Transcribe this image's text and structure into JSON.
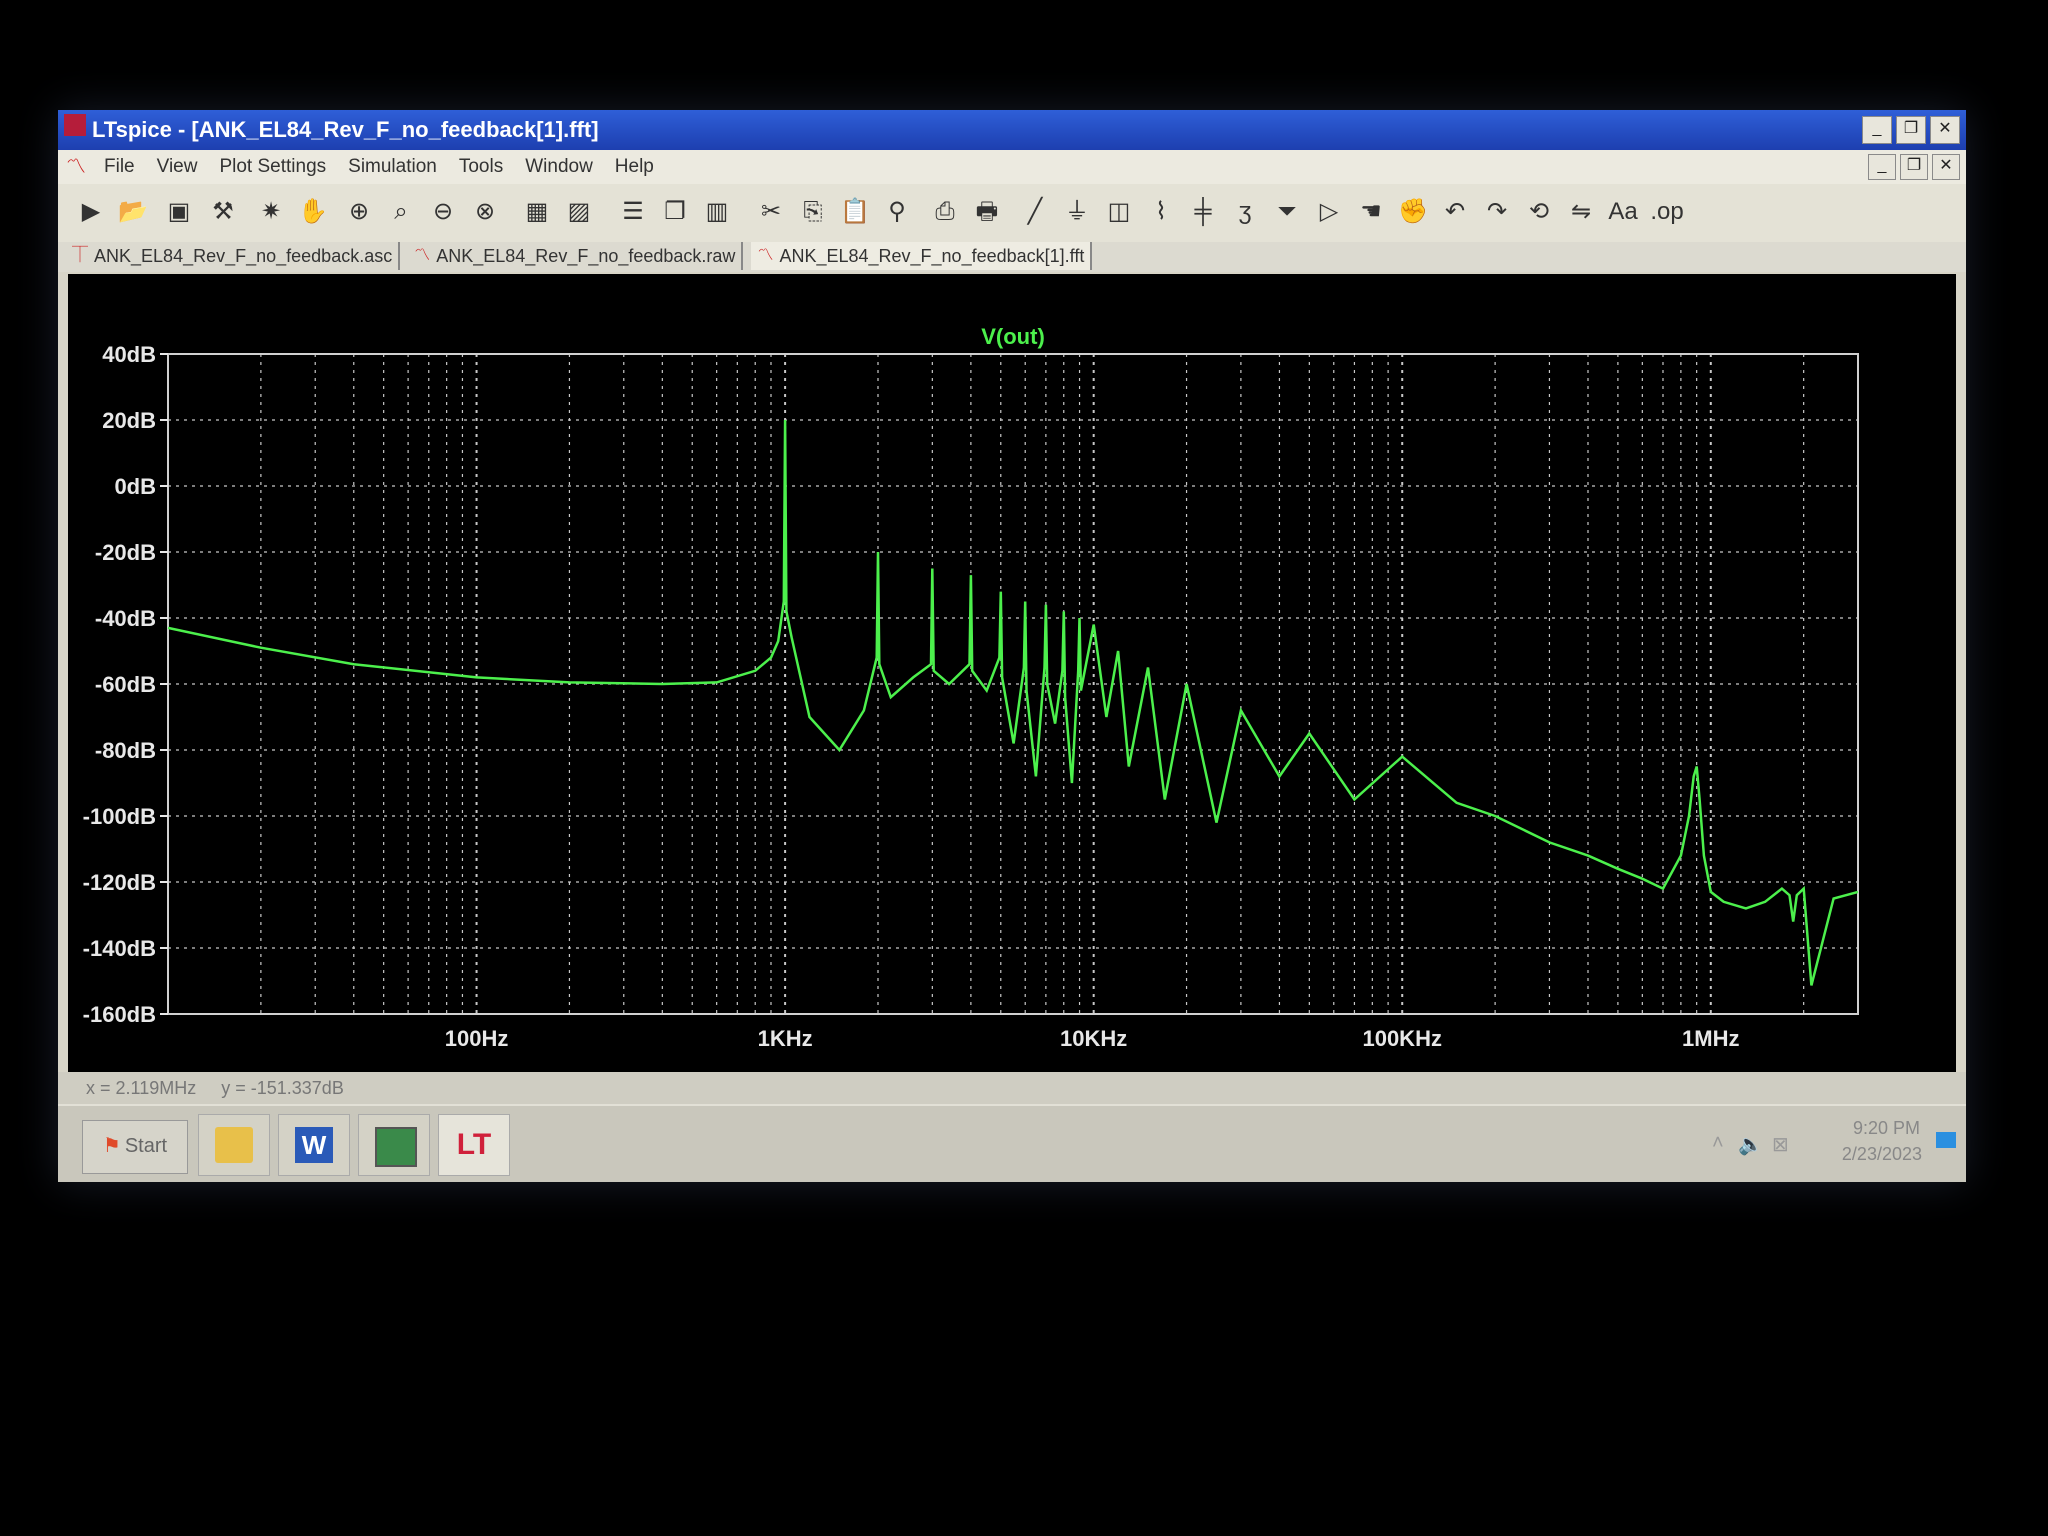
{
  "window": {
    "title": "LTspice - [ANK_EL84_Rev_F_no_feedback[1].fft]",
    "controls": {
      "minimize": "_",
      "restore": "❐",
      "close": "✕"
    }
  },
  "menu": [
    "File",
    "View",
    "Plot Settings",
    "Simulation",
    "Tools",
    "Window",
    "Help"
  ],
  "toolbar": [
    "run-icon",
    "open-icon",
    "save-icon",
    "control-panel-icon",
    "halt-icon",
    "pan-icon",
    "zoom-in-icon",
    "zoom-fit-icon",
    "zoom-out-icon",
    "zoom-cancel-icon",
    "autorange-icon",
    "zoom-area-icon",
    "tile-horizontal-icon",
    "cascade-icon",
    "tile-vertical-icon",
    "cut-icon",
    "copy-icon",
    "paste-icon",
    "find-icon",
    "print-preview-icon",
    "print-icon",
    "wire-icon",
    "ground-icon",
    "label-icon",
    "resistor-icon",
    "capacitor-icon",
    "inductor-icon",
    "diode-icon",
    "component-icon",
    "move-icon",
    "drag-icon",
    "undo-icon",
    "redo-icon",
    "rotate-icon",
    "mirror-icon",
    "text-icon",
    "spice-directive-icon"
  ],
  "tabs": [
    {
      "label": "ANK_EL84_Rev_F_no_feedback.asc",
      "icon": "schematic-icon",
      "active": false
    },
    {
      "label": "ANK_EL84_Rev_F_no_feedback.raw",
      "icon": "waveform-icon",
      "active": false
    },
    {
      "label": "ANK_EL84_Rev_F_no_feedback[1].fft",
      "icon": "waveform-icon",
      "active": true
    }
  ],
  "status": {
    "x": "x = 2.119MHz",
    "y": "y = -151.337dB"
  },
  "taskbar": {
    "start_label": "Start",
    "apps": [
      "file-explorer-icon",
      "word-icon",
      "monitor-app-icon",
      "ltspice-icon"
    ],
    "time": "9:20 PM",
    "date": "2/23/2023"
  },
  "colors": {
    "trace": "#4cf04c",
    "grid": "#c8c8c8",
    "plot_bg": "#000000",
    "title_bar": "#2a56d0"
  },
  "chart_data": {
    "type": "line",
    "title": "V(out)",
    "xscale": "log",
    "xlim": [
      10,
      3000000
    ],
    "ylim": [
      -160,
      40
    ],
    "grid": true,
    "xticks": [
      {
        "value": 100,
        "label": "100Hz"
      },
      {
        "value": 1000,
        "label": "1KHz"
      },
      {
        "value": 10000,
        "label": "10KHz"
      },
      {
        "value": 100000,
        "label": "100KHz"
      },
      {
        "value": 1000000,
        "label": "1MHz"
      }
    ],
    "yticks": [
      {
        "value": 40,
        "label": "40dB"
      },
      {
        "value": 20,
        "label": "20dB"
      },
      {
        "value": 0,
        "label": "0dB"
      },
      {
        "value": -20,
        "label": "-20dB"
      },
      {
        "value": -40,
        "label": "-40dB"
      },
      {
        "value": -60,
        "label": "-60dB"
      },
      {
        "value": -80,
        "label": "-80dB"
      },
      {
        "value": -100,
        "label": "-100dB"
      },
      {
        "value": -120,
        "label": "-120dB"
      },
      {
        "value": -140,
        "label": "-140dB"
      },
      {
        "value": -160,
        "label": "-160dB"
      }
    ],
    "series": [
      {
        "x": [
          10,
          20,
          40,
          100,
          200,
          400,
          600,
          800,
          900,
          950,
          990,
          1000,
          1010,
          1050,
          1200,
          1500,
          1800,
          1980,
          2000,
          2020,
          2200,
          2600,
          2970,
          3000,
          3030,
          3400,
          3960,
          4000,
          4040,
          4500,
          4950,
          5000,
          5050,
          5500,
          5940,
          6000,
          6060,
          6500,
          6930,
          7000,
          7070,
          7500,
          7920,
          8000,
          8080,
          8500,
          8910,
          9000,
          9090,
          10000,
          11000,
          12000,
          13000,
          15000,
          17000,
          20000,
          25000,
          30000,
          40000,
          50000,
          70000,
          100000,
          150000,
          200000,
          300000,
          400000,
          500000,
          600000,
          700000,
          800000,
          850000,
          880000,
          900000,
          920000,
          950000,
          1000000,
          1100000,
          1300000,
          1500000,
          1700000,
          1800000,
          1850000,
          1900000,
          2000000,
          2119000,
          2500000,
          3000000
        ],
        "y": [
          -43,
          -49,
          -54,
          -58,
          -59.5,
          -60,
          -59.5,
          -56,
          -52,
          -47,
          -35,
          20,
          -38,
          -46,
          -70,
          -80,
          -68,
          -52,
          -20,
          -54,
          -64,
          -58,
          -54,
          -25,
          -56,
          -60,
          -54,
          -27,
          -56,
          -62,
          -52,
          -32,
          -58,
          -78,
          -55,
          -35,
          -62,
          -88,
          -55,
          -36,
          -60,
          -72,
          -56,
          -38,
          -64,
          -90,
          -56,
          -40,
          -62,
          -42,
          -70,
          -50,
          -85,
          -55,
          -95,
          -60,
          -102,
          -68,
          -88,
          -75,
          -95,
          -82,
          -96,
          -100,
          -108,
          -112,
          -116,
          -119,
          -122,
          -112,
          -100,
          -88,
          -85,
          -95,
          -112,
          -123,
          -126,
          -128,
          -126,
          -122,
          -124,
          -132,
          -124,
          -122,
          -151.337,
          -125,
          -123
        ]
      }
    ]
  }
}
